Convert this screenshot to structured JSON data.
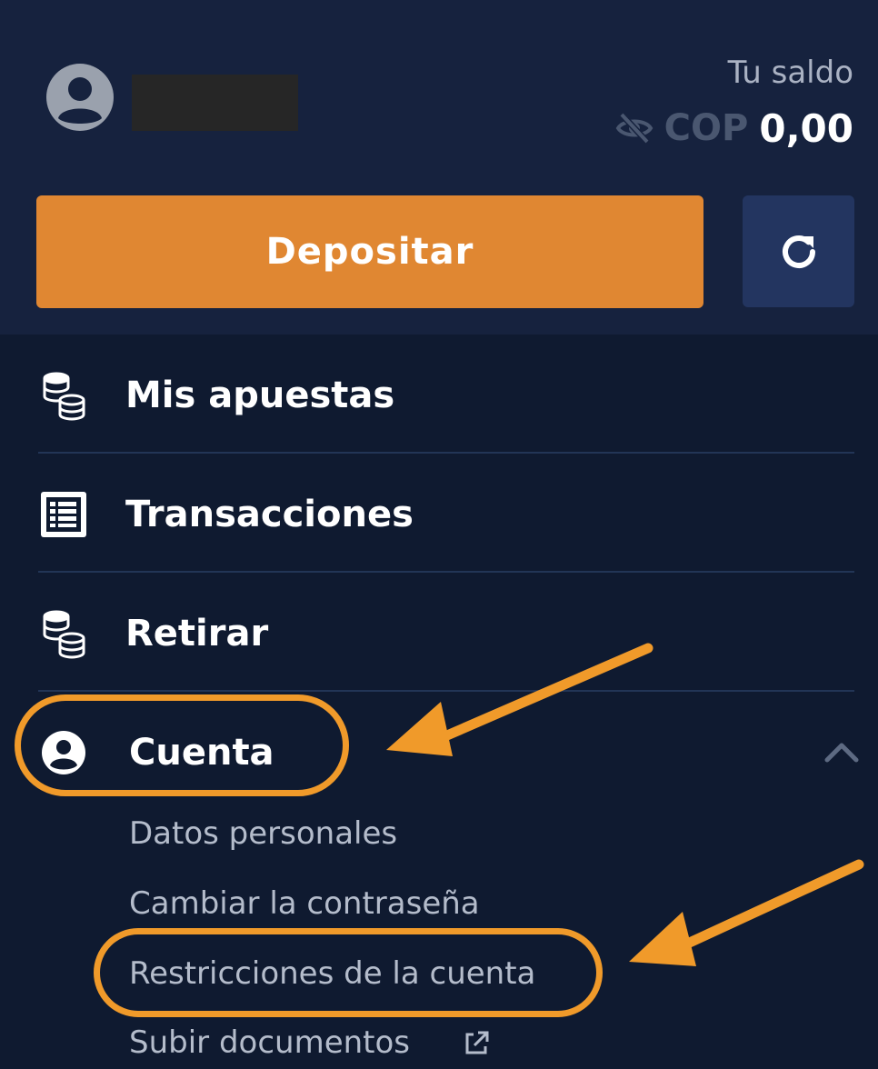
{
  "balance": {
    "label": "Tu saldo",
    "currency": "COP",
    "amount": "0,00"
  },
  "actions": {
    "deposit_label": "Depositar"
  },
  "menu": {
    "items": [
      {
        "label": "Mis apuestas",
        "icon": "coins-icon"
      },
      {
        "label": "Transacciones",
        "icon": "list-icon"
      },
      {
        "label": "Retirar",
        "icon": "coins-icon"
      },
      {
        "label": "Cuenta",
        "icon": "user-circle-icon",
        "expanded": true
      }
    ],
    "account_submenu": [
      {
        "label": "Datos personales"
      },
      {
        "label": "Cambiar la contraseña"
      },
      {
        "label": "Restricciones de la cuenta"
      },
      {
        "label": "Subir documentos",
        "icon": "external-link-icon"
      }
    ]
  },
  "colors": {
    "accent": "#e08732",
    "highlight": "#f09a2a",
    "panel": "#16223e",
    "background": "#0f1a30"
  }
}
